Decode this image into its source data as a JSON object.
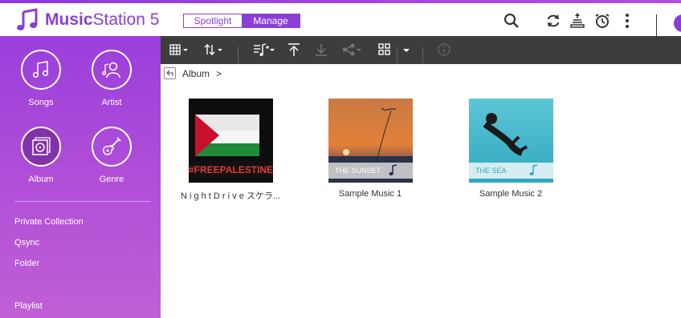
{
  "app": {
    "name_bold": "Music",
    "name_rest": "Station 5",
    "modes": [
      {
        "label": "Spotlight",
        "active": false
      },
      {
        "label": "Manage",
        "active": true
      }
    ]
  },
  "header_icons": [
    "search-icon",
    "refresh-icon",
    "background-task-icon",
    "alarm-clock-icon",
    "more-vertical-icon"
  ],
  "sidebar": {
    "categories": [
      {
        "label": "Songs",
        "icon": "music-note-icon",
        "selected": false
      },
      {
        "label": "Artist",
        "icon": "artist-icon",
        "selected": false
      },
      {
        "label": "Album",
        "icon": "album-icon",
        "selected": true
      },
      {
        "label": "Genre",
        "icon": "guitar-icon",
        "selected": false
      }
    ],
    "links": [
      "Private Collection",
      "Qsync",
      "Folder",
      "Playlist"
    ]
  },
  "toolbar_icons": [
    "grid-view-icon",
    "sort-icon",
    "add-to-playlist-icon",
    "upload-icon",
    "download-icon",
    "share-icon",
    "select-icon",
    "dropdown-icon",
    "info-icon"
  ],
  "breadcrumb": {
    "current": "Album",
    "separator": ">"
  },
  "albums": [
    {
      "title": "N i g h t D r i v e スケラ...",
      "cover_text": "#FREEPALESTINE"
    },
    {
      "title": "Sample Music 1",
      "cover_text": "THE SUNSET"
    },
    {
      "title": "Sample Music 2",
      "cover_text": "THE SEA"
    }
  ],
  "colors": {
    "accent": "#8a3fd4",
    "sidebar_top": "#9a3fdc",
    "sidebar_bottom": "#c15fd6",
    "toolbar": "#3d3d3d"
  }
}
